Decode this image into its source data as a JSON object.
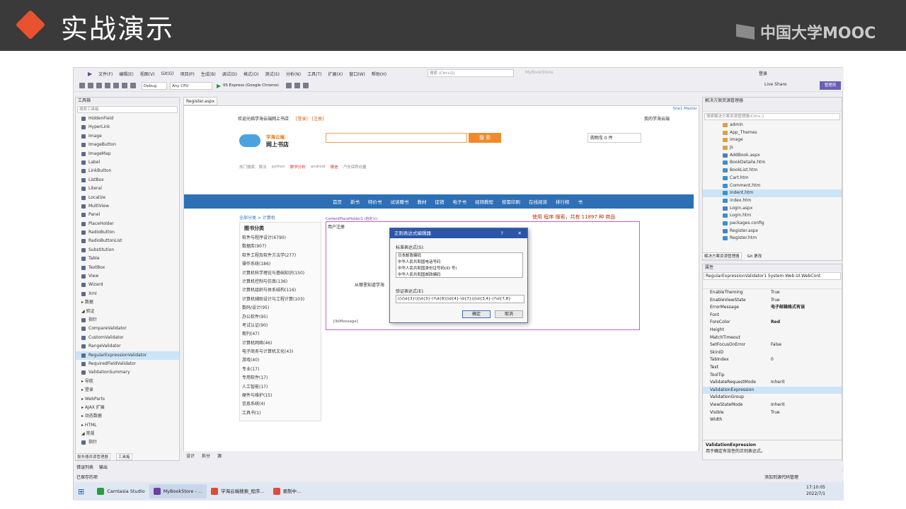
{
  "slide": {
    "title": "实战演示",
    "brand": "中国大学MOOC"
  },
  "vs": {
    "menu": [
      "文件(F)",
      "编辑(E)",
      "视图(V)",
      "Git(G)",
      "项目(P)",
      "生成(B)",
      "调试(D)",
      "格式(O)",
      "测试(S)",
      "分析(N)",
      "工具(T)",
      "扩展(X)",
      "窗口(W)",
      "帮助(H)"
    ],
    "search_placeholder": "搜索 (Ctrl+Q)",
    "solution_name": "MyBookStore",
    "login": "登录",
    "config": "Debug",
    "platform": "Any CPU",
    "run_target": "IIS Express (Google Chrome)",
    "live_share": "Live Share",
    "admin": "管理员"
  },
  "toolbox": {
    "title": "工具箱",
    "search": "搜索工具箱",
    "items": [
      {
        "label": "HiddenField",
        "type": "item"
      },
      {
        "label": "HyperLink",
        "type": "item"
      },
      {
        "label": "Image",
        "type": "item"
      },
      {
        "label": "ImageButton",
        "type": "item"
      },
      {
        "label": "ImageMap",
        "type": "item"
      },
      {
        "label": "Label",
        "type": "item"
      },
      {
        "label": "LinkButton",
        "type": "item"
      },
      {
        "label": "ListBox",
        "type": "item"
      },
      {
        "label": "Literal",
        "type": "item"
      },
      {
        "label": "Localize",
        "type": "item"
      },
      {
        "label": "MultiView",
        "type": "item"
      },
      {
        "label": "Panel",
        "type": "item"
      },
      {
        "label": "PlaceHolder",
        "type": "item"
      },
      {
        "label": "RadioButton",
        "type": "item"
      },
      {
        "label": "RadioButtonList",
        "type": "item"
      },
      {
        "label": "Substitution",
        "type": "item"
      },
      {
        "label": "Table",
        "type": "item"
      },
      {
        "label": "TextBox",
        "type": "item"
      },
      {
        "label": "View",
        "type": "item"
      },
      {
        "label": "Wizard",
        "type": "item"
      },
      {
        "label": "Xml",
        "type": "item"
      },
      {
        "label": "▸ 数据",
        "type": "cat"
      },
      {
        "label": "◢ 验证",
        "type": "cat"
      },
      {
        "label": "指针",
        "type": "item"
      },
      {
        "label": "CompareValidator",
        "type": "item"
      },
      {
        "label": "CustomValidator",
        "type": "item"
      },
      {
        "label": "RangeValidator",
        "type": "item"
      },
      {
        "label": "RegularExpressionValidator",
        "type": "sel"
      },
      {
        "label": "RequiredFieldValidator",
        "type": "item"
      },
      {
        "label": "ValidationSummary",
        "type": "item"
      },
      {
        "label": "▸ 导航",
        "type": "cat"
      },
      {
        "label": "▸ 登录",
        "type": "cat"
      },
      {
        "label": "▸ WebParts",
        "type": "cat"
      },
      {
        "label": "▸ AJAX 扩展",
        "type": "cat"
      },
      {
        "label": "▸ 动态数据",
        "type": "cat"
      },
      {
        "label": "▸ HTML",
        "type": "cat"
      },
      {
        "label": "◢ 常规",
        "type": "cat"
      },
      {
        "label": "指针",
        "type": "item"
      }
    ],
    "tabs": [
      "服务器资源管理器",
      "工具箱"
    ]
  },
  "designer": {
    "tab": "Register.aspx",
    "master": "Site1.Master",
    "welcome": "欢迎光临学海云端网上书店",
    "login_link": "[登录]",
    "register_link": "[注册]",
    "my_store": "我的学海云端",
    "site_name_1": "学海云端",
    "site_name_2": "网上书店",
    "search_btn": "搜 索",
    "cart": "购物车 0 件",
    "hot_label": "热门搜索：算法",
    "hot_tags": [
      "python",
      "数学分析",
      "android",
      "微信",
      "汽车保养向量"
    ],
    "nav": [
      "首页",
      "新书",
      "特价书",
      "试读赠书",
      "教材",
      "促销",
      "电子书",
      "视频教程",
      "按需印刷",
      "在线阅读",
      "排行榜",
      "书"
    ],
    "breadcrumb": "全部分类 > 计算机",
    "search_stat": "使用 程序 搜索，共有 11897 种 商品",
    "category_title": "图书分类",
    "categories": [
      "软件与程序设计(6790)",
      "数据库(907)",
      "软件工程及软件方法学(277)",
      "操作系统(186)",
      "计算机科学理论与基础知识(150)",
      "计算机控制与仿真(136)",
      "计算机组织与体系结构(116)",
      "计算机辅助设计与工程计算(103)",
      "数码/设计(95)",
      "办公软件(95)",
      "考试认证(90)",
      "期刊(47)",
      "计算机网络(46)",
      "电子商务与计算机文化(43)",
      "游戏(40)",
      "专业(17)",
      "专用软件(17)",
      "人工智能(17)",
      "硬件与维护(15)",
      "信息系统(4)",
      "工具书(1)"
    ],
    "content_holder": "ContentPlaceHolder1 (自定义)",
    "register_title": "用户注册",
    "question_label": "从哪里知道学海",
    "lblmessage": "[lblMessage]",
    "bottom_tabs": [
      "设计",
      "拆分",
      "源"
    ]
  },
  "dialog": {
    "title": "正则表达式编辑器",
    "help": "?",
    "std_label": "标准表达式(S):",
    "std_items": [
      "日本邮政编码",
      "中华人民共和国电话号码",
      "中华人民共和国身份证号码(ID 号)",
      "中华人民共和国邮政编码"
    ],
    "expr_label": "验证表达式(E):",
    "expr_value": "((\\(\\d{3}\\)|\\d{3}-)?\\d{8}|\\d{4}-\\d{7})|(\\d{3,4}-)?\\d{7,8}",
    "ok": "确定",
    "cancel": "取消"
  },
  "solution": {
    "title": "解决方案资源管理器",
    "search": "搜索解决方案资源管理器(Ctrl+;)",
    "items": [
      {
        "label": "admin",
        "kind": "folder"
      },
      {
        "label": "App_Themes",
        "kind": "folder"
      },
      {
        "label": "image",
        "kind": "folder"
      },
      {
        "label": "Js",
        "kind": "folder"
      },
      {
        "label": "AddBook.aspx",
        "kind": "aspx"
      },
      {
        "label": "BookDetaile.htm",
        "kind": "htm"
      },
      {
        "label": "BookList.htm",
        "kind": "htm"
      },
      {
        "label": "Cart.htm",
        "kind": "htm"
      },
      {
        "label": "Comment.htm",
        "kind": "htm"
      },
      {
        "label": "Indent.htm",
        "kind": "sel"
      },
      {
        "label": "index.htm",
        "kind": "htm"
      },
      {
        "label": "Login.aspx",
        "kind": "aspx"
      },
      {
        "label": "Login.htm",
        "kind": "htm"
      },
      {
        "label": "packages.config",
        "kind": "htm"
      },
      {
        "label": "Register.aspx",
        "kind": "aspx"
      },
      {
        "label": "Register.htm",
        "kind": "htm"
      }
    ],
    "tabs": [
      "解决方案资源管理器",
      "Git 更改"
    ]
  },
  "properties": {
    "title": "属性",
    "object": "RegularExpressionValidator1  System.Web.UI.WebCont",
    "rows": [
      {
        "k": "EnableTheming",
        "v": "True"
      },
      {
        "k": "EnableViewState",
        "v": "True"
      },
      {
        "k": "ErrorMessage",
        "v": "电子邮箱格式有误"
      },
      {
        "k": "Font",
        "v": ""
      },
      {
        "k": "ForeColor",
        "v": "Red"
      },
      {
        "k": "Height",
        "v": ""
      },
      {
        "k": "MatchTimeout",
        "v": ""
      },
      {
        "k": "SetFocusOnError",
        "v": "False"
      },
      {
        "k": "SkinID",
        "v": ""
      },
      {
        "k": "TabIndex",
        "v": "0"
      },
      {
        "k": "Text",
        "v": ""
      },
      {
        "k": "ToolTip",
        "v": ""
      },
      {
        "k": "ValidateRequestMode",
        "v": "Inherit"
      },
      {
        "k": "ValidationExpression",
        "v": ""
      },
      {
        "k": "ValidationGroup",
        "v": ""
      },
      {
        "k": "ViewStateMode",
        "v": "Inherit"
      },
      {
        "k": "Visible",
        "v": "True"
      },
      {
        "k": "Width",
        "v": ""
      }
    ],
    "desc_title": "ValidationExpression",
    "desc": "用于确定有效性的正则表达式。"
  },
  "status": {
    "tabs": [
      "错误列表",
      "输出"
    ],
    "text": "已保存的项",
    "source_control": "添加到源代码管理"
  },
  "taskbar": {
    "apps": [
      {
        "label": "Camtasia Studio",
        "color": "#2a9d3a"
      },
      {
        "label": "MyBookStore - ...",
        "color": "#6b3fa0"
      },
      {
        "label": "学海云端搜索_程序...",
        "color": "#dd4b39"
      },
      {
        "label": "录制中...",
        "color": "#e04a3a"
      }
    ],
    "time": "17:10:05",
    "date": "2022/7/1"
  }
}
